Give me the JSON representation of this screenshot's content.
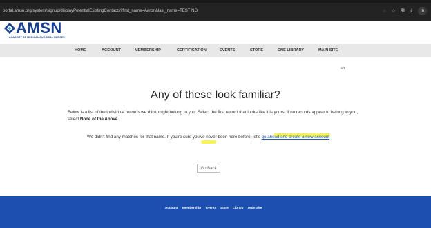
{
  "browser": {
    "url": "portal.amsn.org/system/signup/displayPotentialExistingContacts?first_name=Aaron&last_name=TESTING",
    "profile_label": "In"
  },
  "logo": {
    "name": "AMSN",
    "tagline": "ACADEMY OF MEDICAL-SURGICAL NURSES"
  },
  "nav": {
    "items": [
      "HOME",
      "ACCOUNT",
      "MEMBERSHIP",
      "CERTIFICATION",
      "EVENTS",
      "STORE",
      "CNE LIBRARY",
      "MAIN SITE"
    ]
  },
  "language_toggle": "a ▾",
  "headline": "Any of these look familiar?",
  "intro": {
    "text": "Below is a list of the individual records we think might belong to you. Select the first record that looks like it is yours. If no records appear to belong to you, select ",
    "emphasis": "None of the Above."
  },
  "no_match": {
    "text": "We didn't find any matches for that name. If you're sure you've never been here before, let's ",
    "link": "go ahead and create a new account"
  },
  "go_back_label": "Go Back",
  "footer": {
    "links": [
      "Account",
      "Membership",
      "Events",
      "Store",
      "Library",
      "Main Site"
    ]
  },
  "colors": {
    "brand_blue": "#1a3f8f",
    "footer_blue": "#1d4fb1",
    "highlight": "#f4f11a"
  }
}
